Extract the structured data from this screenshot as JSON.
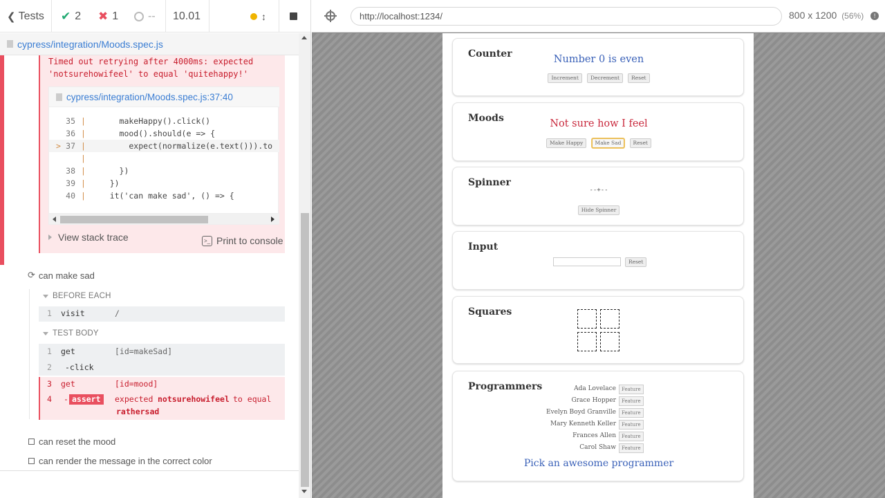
{
  "reporter": {
    "tests_label": "Tests",
    "passed": "2",
    "failed": "1",
    "pending": "--",
    "duration": "10.01",
    "spec_file": "cypress/integration/Moods.spec.js"
  },
  "error": {
    "message_line1": "Timed out retrying after 4000ms: expected",
    "message_line2": "'notsurehowifeel' to equal 'quitehappy!'",
    "code_file": "cypress/integration/Moods.spec.js:37:40",
    "code_lines": [
      {
        "num": "35",
        "marker": "",
        "code": "      makeHappy().click()"
      },
      {
        "num": "36",
        "marker": "",
        "code": "      mood().should(e => {"
      },
      {
        "num": "37",
        "marker": ">",
        "code": "        expect(normalize(e.text())).to"
      },
      {
        "num": "",
        "marker": "",
        "code": ""
      },
      {
        "num": "38",
        "marker": "",
        "code": "      })"
      },
      {
        "num": "39",
        "marker": "",
        "code": "    })"
      },
      {
        "num": "40",
        "marker": "",
        "code": "    it('can make sad', () => {"
      }
    ],
    "view_stack": "View stack trace",
    "print_console": "Print to console"
  },
  "test_sad": {
    "title": "can make sad",
    "before_each": "BEFORE EACH",
    "test_body": "TEST BODY",
    "before_cmds": [
      {
        "num": "1",
        "cmd": "visit",
        "arg": "/"
      }
    ],
    "body_cmds": [
      {
        "num": "1",
        "cmd": "get",
        "arg": "[id=makeSad]"
      },
      {
        "num": "2",
        "cmd": "-click",
        "arg": ""
      },
      {
        "num": "3",
        "cmd": "get",
        "arg": "[id=mood]"
      }
    ],
    "assert": {
      "num": "4",
      "badge": "assert",
      "pre": "expected",
      "val1": "notsurehowifeel",
      "mid": "to equal",
      "val2": "rathersad"
    }
  },
  "other_tests": [
    "can reset the mood",
    "can render the message in the correct color"
  ],
  "runner": {
    "url": "http://localhost:1234/",
    "viewport": "800 x 1200",
    "scale": "(56%)"
  },
  "app": {
    "counter": {
      "title": "Counter",
      "message": "Number 0 is even",
      "buttons": [
        "Increment",
        "Decrement",
        "Reset"
      ]
    },
    "moods": {
      "title": "Moods",
      "message": "Not sure how I feel",
      "buttons": [
        "Make Happy",
        "Make Sad",
        "Reset"
      ]
    },
    "spinner": {
      "title": "Spinner",
      "glyph": "--+--",
      "button": "Hide Spinner"
    },
    "input": {
      "title": "Input",
      "button": "Reset"
    },
    "squares": {
      "title": "Squares"
    },
    "programmers": {
      "title": "Programmers",
      "names": [
        "Ada Lovelace",
        "Grace Hopper",
        "Evelyn Boyd Granville",
        "Mary Kenneth Keller",
        "Frances Allen",
        "Carol Shaw"
      ],
      "feature_label": "Feature",
      "pick": "Pick an awesome programmer"
    }
  },
  "colors": {
    "fail": "#e94f5f",
    "pass": "#1fa971",
    "link": "#3a7dd3",
    "mood_text": "#c8273b",
    "counter_text": "#3a61b8"
  }
}
